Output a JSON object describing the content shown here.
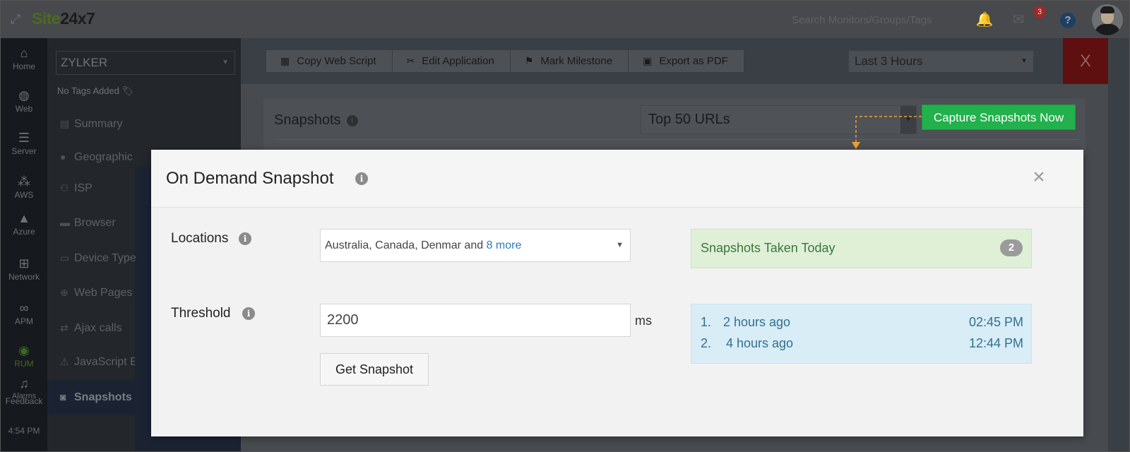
{
  "header": {
    "logo_part1": "Site",
    "logo_part2": "24x7",
    "search_placeholder": "Search Monitors/Groups/Tags",
    "alert_count": "3",
    "help_label": "?",
    "icons": [
      "expand-icon",
      "bell-icon",
      "alarm-icon",
      "help-icon",
      "avatar"
    ]
  },
  "left_nav": {
    "items": [
      {
        "label": "Home",
        "icon": "home-icon"
      },
      {
        "label": "Web",
        "icon": "globe-icon"
      },
      {
        "label": "Server",
        "icon": "server-icon"
      },
      {
        "label": "AWS",
        "icon": "aws-icon"
      },
      {
        "label": "Azure",
        "icon": "azure-icon"
      },
      {
        "label": "Network",
        "icon": "network-icon"
      },
      {
        "label": "APM",
        "icon": "apm-icon"
      },
      {
        "label": "RUM",
        "icon": "rum-icon"
      },
      {
        "label": "Feedback",
        "icon": "feedback-icon"
      },
      {
        "label": "Alarms",
        "icon": "alarms-icon"
      }
    ],
    "time": "4:54 PM"
  },
  "sub_nav": {
    "monitor": "ZYLKER",
    "tags": "No Tags Added",
    "items": [
      {
        "label": "Summary"
      },
      {
        "label": "Geographic"
      },
      {
        "label": "ISP"
      },
      {
        "label": "Browser"
      },
      {
        "label": "Device Type"
      },
      {
        "label": "Web Pages"
      },
      {
        "label": "Ajax calls"
      },
      {
        "label": "JavaScript Errors"
      },
      {
        "label": "Snapshots"
      }
    ]
  },
  "toolbar": {
    "buttons": [
      "Copy Web Script",
      "Edit Application",
      "Mark Milestone",
      "Export as PDF"
    ],
    "time_range": "Last 3 Hours",
    "close_label": "X"
  },
  "snapshots_card": {
    "title": "Snapshots",
    "url_filter": "Top 50 URLs",
    "capture_label": "Capture Snapshots Now"
  },
  "modal": {
    "title": "On Demand Snapshot",
    "close_label": "×",
    "locations_label": "Locations",
    "locations_value": "Australia, Canada, Denmar and",
    "locations_more": "8 more",
    "threshold_label": "Threshold",
    "threshold_value": "2200",
    "threshold_unit": "ms",
    "get_snapshot_label": "Get Snapshot",
    "snapshots_today_label": "Snapshots Taken Today",
    "snapshots_today_count": "2",
    "history": [
      {
        "num": "1.",
        "ago": "2 hours ago",
        "time": "02:45 PM"
      },
      {
        "num": "2.",
        "ago": "4 hours ago",
        "time": "12:44 PM"
      }
    ]
  },
  "colors": {
    "capture_button": "#22b14c",
    "today_bg": "#dff0d7",
    "today_text": "#3c763d",
    "history_bg": "#d9edf7",
    "history_text": "#31708f",
    "link": "#2e7bbf",
    "arrow": "#f0a030"
  }
}
